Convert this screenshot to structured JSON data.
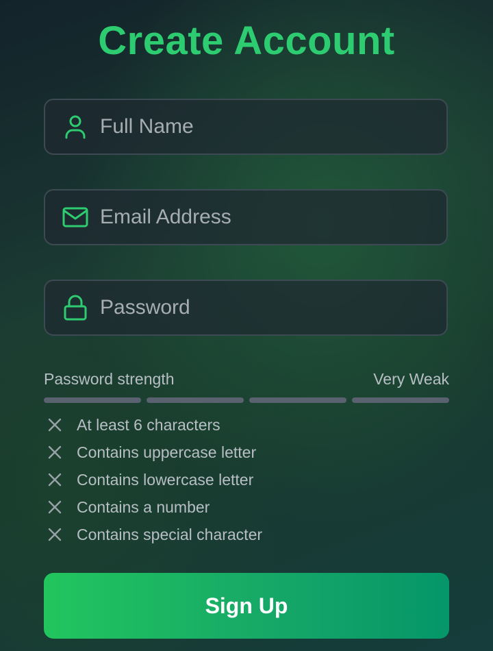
{
  "title": "Create Account",
  "fields": {
    "full_name": {
      "placeholder": "Full Name",
      "value": "",
      "icon": "user-icon"
    },
    "email": {
      "placeholder": "Email Address",
      "value": "",
      "icon": "mail-icon"
    },
    "password": {
      "placeholder": "Password",
      "value": "",
      "icon": "lock-icon"
    }
  },
  "strength": {
    "label": "Password strength",
    "level_text": "Very Weak",
    "segments_total": 4,
    "segments_filled": 0
  },
  "requirements": [
    {
      "label": "At least 6 characters",
      "met": false,
      "icon": "x-icon"
    },
    {
      "label": "Contains uppercase letter",
      "met": false,
      "icon": "x-icon"
    },
    {
      "label": "Contains lowercase letter",
      "met": false,
      "icon": "x-icon"
    },
    {
      "label": "Contains a number",
      "met": false,
      "icon": "x-icon"
    },
    {
      "label": "Contains special character",
      "met": false,
      "icon": "x-icon"
    }
  ],
  "submit": {
    "label": "Sign Up"
  },
  "colors": {
    "accent": "#2ecc71",
    "bar_empty": "#5a6270",
    "button_start": "#22c55e",
    "button_end": "#059669"
  }
}
